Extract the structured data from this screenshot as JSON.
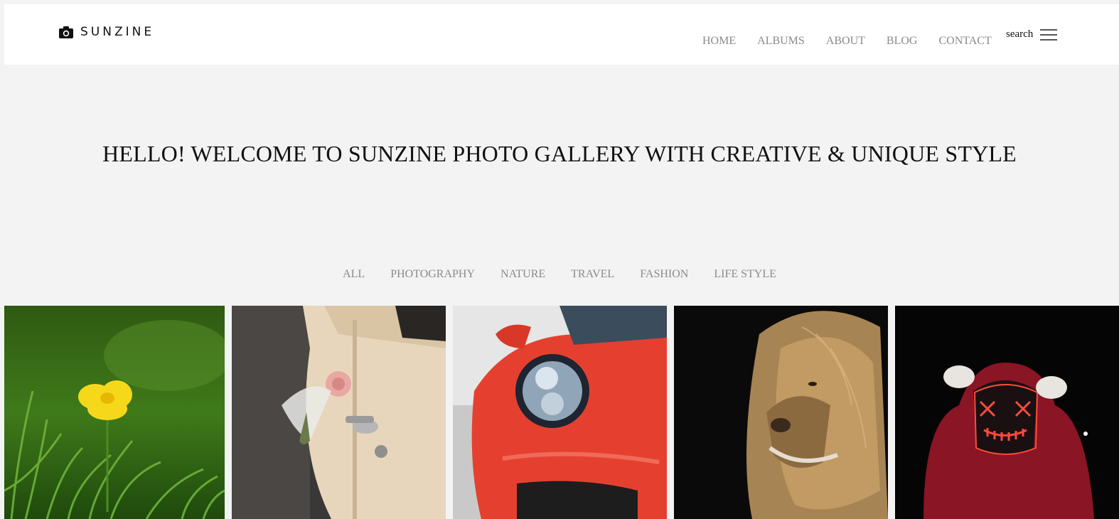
{
  "brand": {
    "name": "SUNZINE",
    "icon": "camera-icon"
  },
  "nav": {
    "items": [
      {
        "label": "HOME"
      },
      {
        "label": "ALBUMS"
      },
      {
        "label": "ABOUT"
      },
      {
        "label": "BLOG"
      },
      {
        "label": "CONTACT"
      }
    ],
    "search_label": "search",
    "menu_icon": "hamburger-icon"
  },
  "hero": {
    "title": "HELLO! WELCOME TO SUNZINE PHOTO GALLERY WITH CREATIVE & UNIQUE STYLE"
  },
  "filters": [
    {
      "label": "ALL"
    },
    {
      "label": "PHOTOGRAPHY"
    },
    {
      "label": "NATURE"
    },
    {
      "label": "TRAVEL"
    },
    {
      "label": "FASHION"
    },
    {
      "label": "LIFE STYLE"
    }
  ],
  "gallery": [
    {
      "subject": "yellow-flower-photo"
    },
    {
      "subject": "vintage-car-door-rose-photo"
    },
    {
      "subject": "red-sports-car-headlight-photo"
    },
    {
      "subject": "lion-portrait-photo"
    },
    {
      "subject": "neon-mask-hoodie-photo"
    }
  ],
  "colors": {
    "page_background": "#f3f3f3",
    "header_background": "#ffffff",
    "nav_text": "#8a8a8a",
    "title_text": "#111111"
  }
}
